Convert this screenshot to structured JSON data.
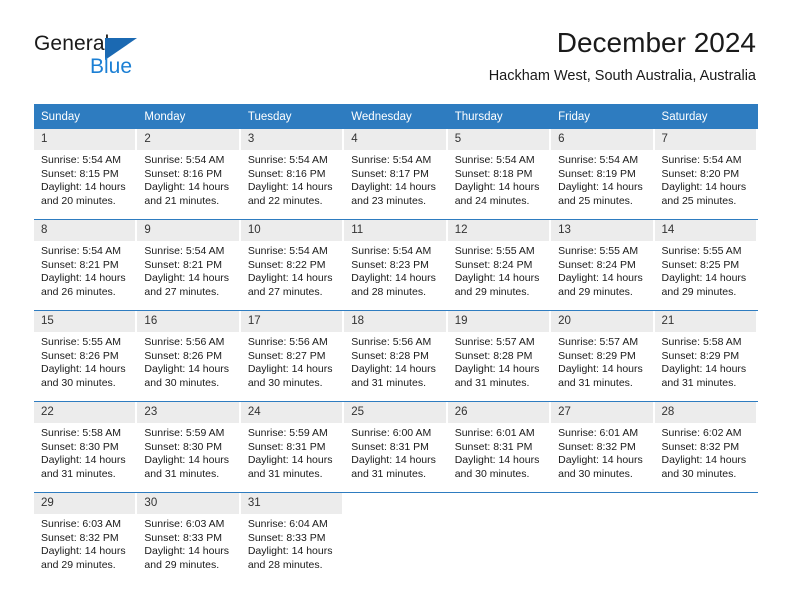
{
  "brand": {
    "word_one": "General",
    "word_two": "Blue",
    "triangle_icon": "triangle-icon",
    "accent_blue": "#1b69b2",
    "light_blue": "#1b7fd4"
  },
  "header": {
    "title": "December 2024",
    "subtitle": "Hackham West, South Australia, Australia"
  },
  "colors": {
    "header_row_bg": "#2e7cc0",
    "daynum_bg": "#ececec",
    "row_divider": "#2e7cc0",
    "text": "#1a1a1a"
  },
  "weekday_headers": [
    "Sunday",
    "Monday",
    "Tuesday",
    "Wednesday",
    "Thursday",
    "Friday",
    "Saturday"
  ],
  "weeks": [
    [
      {
        "day": "1",
        "sunrise": "Sunrise: 5:54 AM",
        "sunset": "Sunset: 8:15 PM",
        "daylight_line1": "Daylight: 14 hours",
        "daylight_line2": "and 20 minutes."
      },
      {
        "day": "2",
        "sunrise": "Sunrise: 5:54 AM",
        "sunset": "Sunset: 8:16 PM",
        "daylight_line1": "Daylight: 14 hours",
        "daylight_line2": "and 21 minutes."
      },
      {
        "day": "3",
        "sunrise": "Sunrise: 5:54 AM",
        "sunset": "Sunset: 8:16 PM",
        "daylight_line1": "Daylight: 14 hours",
        "daylight_line2": "and 22 minutes."
      },
      {
        "day": "4",
        "sunrise": "Sunrise: 5:54 AM",
        "sunset": "Sunset: 8:17 PM",
        "daylight_line1": "Daylight: 14 hours",
        "daylight_line2": "and 23 minutes."
      },
      {
        "day": "5",
        "sunrise": "Sunrise: 5:54 AM",
        "sunset": "Sunset: 8:18 PM",
        "daylight_line1": "Daylight: 14 hours",
        "daylight_line2": "and 24 minutes."
      },
      {
        "day": "6",
        "sunrise": "Sunrise: 5:54 AM",
        "sunset": "Sunset: 8:19 PM",
        "daylight_line1": "Daylight: 14 hours",
        "daylight_line2": "and 25 minutes."
      },
      {
        "day": "7",
        "sunrise": "Sunrise: 5:54 AM",
        "sunset": "Sunset: 8:20 PM",
        "daylight_line1": "Daylight: 14 hours",
        "daylight_line2": "and 25 minutes."
      }
    ],
    [
      {
        "day": "8",
        "sunrise": "Sunrise: 5:54 AM",
        "sunset": "Sunset: 8:21 PM",
        "daylight_line1": "Daylight: 14 hours",
        "daylight_line2": "and 26 minutes."
      },
      {
        "day": "9",
        "sunrise": "Sunrise: 5:54 AM",
        "sunset": "Sunset: 8:21 PM",
        "daylight_line1": "Daylight: 14 hours",
        "daylight_line2": "and 27 minutes."
      },
      {
        "day": "10",
        "sunrise": "Sunrise: 5:54 AM",
        "sunset": "Sunset: 8:22 PM",
        "daylight_line1": "Daylight: 14 hours",
        "daylight_line2": "and 27 minutes."
      },
      {
        "day": "11",
        "sunrise": "Sunrise: 5:54 AM",
        "sunset": "Sunset: 8:23 PM",
        "daylight_line1": "Daylight: 14 hours",
        "daylight_line2": "and 28 minutes."
      },
      {
        "day": "12",
        "sunrise": "Sunrise: 5:55 AM",
        "sunset": "Sunset: 8:24 PM",
        "daylight_line1": "Daylight: 14 hours",
        "daylight_line2": "and 29 minutes."
      },
      {
        "day": "13",
        "sunrise": "Sunrise: 5:55 AM",
        "sunset": "Sunset: 8:24 PM",
        "daylight_line1": "Daylight: 14 hours",
        "daylight_line2": "and 29 minutes."
      },
      {
        "day": "14",
        "sunrise": "Sunrise: 5:55 AM",
        "sunset": "Sunset: 8:25 PM",
        "daylight_line1": "Daylight: 14 hours",
        "daylight_line2": "and 29 minutes."
      }
    ],
    [
      {
        "day": "15",
        "sunrise": "Sunrise: 5:55 AM",
        "sunset": "Sunset: 8:26 PM",
        "daylight_line1": "Daylight: 14 hours",
        "daylight_line2": "and 30 minutes."
      },
      {
        "day": "16",
        "sunrise": "Sunrise: 5:56 AM",
        "sunset": "Sunset: 8:26 PM",
        "daylight_line1": "Daylight: 14 hours",
        "daylight_line2": "and 30 minutes."
      },
      {
        "day": "17",
        "sunrise": "Sunrise: 5:56 AM",
        "sunset": "Sunset: 8:27 PM",
        "daylight_line1": "Daylight: 14 hours",
        "daylight_line2": "and 30 minutes."
      },
      {
        "day": "18",
        "sunrise": "Sunrise: 5:56 AM",
        "sunset": "Sunset: 8:28 PM",
        "daylight_line1": "Daylight: 14 hours",
        "daylight_line2": "and 31 minutes."
      },
      {
        "day": "19",
        "sunrise": "Sunrise: 5:57 AM",
        "sunset": "Sunset: 8:28 PM",
        "daylight_line1": "Daylight: 14 hours",
        "daylight_line2": "and 31 minutes."
      },
      {
        "day": "20",
        "sunrise": "Sunrise: 5:57 AM",
        "sunset": "Sunset: 8:29 PM",
        "daylight_line1": "Daylight: 14 hours",
        "daylight_line2": "and 31 minutes."
      },
      {
        "day": "21",
        "sunrise": "Sunrise: 5:58 AM",
        "sunset": "Sunset: 8:29 PM",
        "daylight_line1": "Daylight: 14 hours",
        "daylight_line2": "and 31 minutes."
      }
    ],
    [
      {
        "day": "22",
        "sunrise": "Sunrise: 5:58 AM",
        "sunset": "Sunset: 8:30 PM",
        "daylight_line1": "Daylight: 14 hours",
        "daylight_line2": "and 31 minutes."
      },
      {
        "day": "23",
        "sunrise": "Sunrise: 5:59 AM",
        "sunset": "Sunset: 8:30 PM",
        "daylight_line1": "Daylight: 14 hours",
        "daylight_line2": "and 31 minutes."
      },
      {
        "day": "24",
        "sunrise": "Sunrise: 5:59 AM",
        "sunset": "Sunset: 8:31 PM",
        "daylight_line1": "Daylight: 14 hours",
        "daylight_line2": "and 31 minutes."
      },
      {
        "day": "25",
        "sunrise": "Sunrise: 6:00 AM",
        "sunset": "Sunset: 8:31 PM",
        "daylight_line1": "Daylight: 14 hours",
        "daylight_line2": "and 31 minutes."
      },
      {
        "day": "26",
        "sunrise": "Sunrise: 6:01 AM",
        "sunset": "Sunset: 8:31 PM",
        "daylight_line1": "Daylight: 14 hours",
        "daylight_line2": "and 30 minutes."
      },
      {
        "day": "27",
        "sunrise": "Sunrise: 6:01 AM",
        "sunset": "Sunset: 8:32 PM",
        "daylight_line1": "Daylight: 14 hours",
        "daylight_line2": "and 30 minutes."
      },
      {
        "day": "28",
        "sunrise": "Sunrise: 6:02 AM",
        "sunset": "Sunset: 8:32 PM",
        "daylight_line1": "Daylight: 14 hours",
        "daylight_line2": "and 30 minutes."
      }
    ],
    [
      {
        "day": "29",
        "sunrise": "Sunrise: 6:03 AM",
        "sunset": "Sunset: 8:32 PM",
        "daylight_line1": "Daylight: 14 hours",
        "daylight_line2": "and 29 minutes."
      },
      {
        "day": "30",
        "sunrise": "Sunrise: 6:03 AM",
        "sunset": "Sunset: 8:33 PM",
        "daylight_line1": "Daylight: 14 hours",
        "daylight_line2": "and 29 minutes."
      },
      {
        "day": "31",
        "sunrise": "Sunrise: 6:04 AM",
        "sunset": "Sunset: 8:33 PM",
        "daylight_line1": "Daylight: 14 hours",
        "daylight_line2": "and 28 minutes."
      },
      {
        "day": "",
        "sunrise": "",
        "sunset": "",
        "daylight_line1": "",
        "daylight_line2": ""
      },
      {
        "day": "",
        "sunrise": "",
        "sunset": "",
        "daylight_line1": "",
        "daylight_line2": ""
      },
      {
        "day": "",
        "sunrise": "",
        "sunset": "",
        "daylight_line1": "",
        "daylight_line2": ""
      },
      {
        "day": "",
        "sunrise": "",
        "sunset": "",
        "daylight_line1": "",
        "daylight_line2": ""
      }
    ]
  ]
}
